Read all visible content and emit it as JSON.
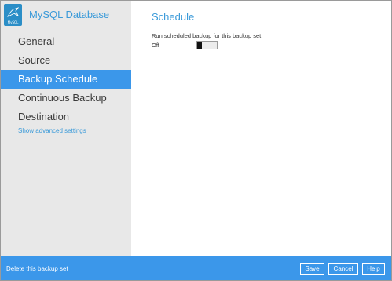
{
  "app": {
    "title": "MySQL Database",
    "logo_text": "MySQL"
  },
  "sidebar": {
    "items": [
      {
        "label": "General",
        "active": false
      },
      {
        "label": "Source",
        "active": false
      },
      {
        "label": "Backup Schedule",
        "active": true
      },
      {
        "label": "Continuous Backup",
        "active": false
      },
      {
        "label": "Destination",
        "active": false
      }
    ],
    "advanced_link": "Show advanced settings"
  },
  "main": {
    "title": "Schedule",
    "option_label": "Run scheduled backup for this backup set",
    "toggle": {
      "state_label": "Off",
      "on": false
    }
  },
  "footer": {
    "delete_link": "Delete this backup set",
    "save_label": "Save",
    "cancel_label": "Cancel",
    "help_label": "Help"
  },
  "colors": {
    "accent": "#3b97ea",
    "sidebar_bg": "#e8e8e8",
    "title_text": "#3a9ad9"
  },
  "icons": {
    "app_logo": "mysql-dolphin-icon"
  }
}
